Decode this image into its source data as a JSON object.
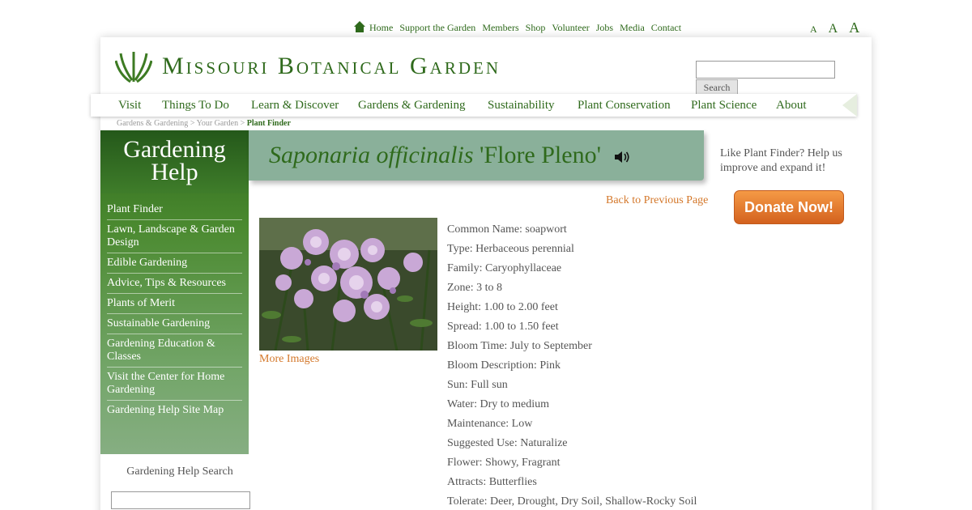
{
  "top_nav": {
    "items": [
      "Home",
      "Support the Garden",
      "Members",
      "Shop",
      "Volunteer",
      "Jobs",
      "Media",
      "Contact"
    ]
  },
  "font_size_controls": [
    "A",
    "A",
    "A"
  ],
  "logo": {
    "text": "Missouri Botanical Garden"
  },
  "site_search": {
    "value": "",
    "button_label": "Search"
  },
  "main_nav": {
    "items": [
      "Visit",
      "Things To Do",
      "Learn & Discover",
      "Gardens & Gardening",
      "Sustainability",
      "Plant Conservation",
      "Plant Science",
      "About"
    ]
  },
  "breadcrumb": {
    "items": [
      "Gardens & Gardening",
      "Your Garden"
    ],
    "separator": ">",
    "current": "Plant Finder"
  },
  "sidebar": {
    "heading_line1": "Gardening",
    "heading_line2": "Help",
    "items": [
      "Plant Finder",
      "Lawn, Landscape & Garden Design",
      "Edible Gardening",
      "Advice, Tips & Resources",
      "Plants of Merit",
      "Sustainable Gardening",
      "Gardening Education & Classes",
      "Visit the Center for Home Gardening",
      "Gardening Help Site Map"
    ],
    "search_label": "Gardening Help Search",
    "search_value": ""
  },
  "plant": {
    "genus_species": "Saponaria officinalis",
    "cultivar": "'Flore Pleno'",
    "back_link": "Back to Previous Page",
    "more_images": "More Images",
    "attributes": [
      "Common Name: soapwort",
      "Type: Herbaceous perennial",
      "Family: Caryophyllaceae",
      "Zone: 3 to 8",
      "Height: 1.00 to 2.00 feet",
      "Spread: 1.00 to 1.50 feet",
      "Bloom Time: July to September",
      "Bloom Description: Pink",
      "Sun: Full sun",
      "Water: Dry to medium",
      "Maintenance: Low",
      "Suggested Use: Naturalize",
      "Flower: Showy, Fragrant",
      "Attracts: Butterflies",
      "Tolerate: Deer, Drought, Dry Soil, Shallow-Rocky Soil"
    ]
  },
  "promo": {
    "text": "Like Plant Finder? Help us improve and expand it!",
    "donate_label": "Donate Now!"
  },
  "colors": {
    "brand_green": "#2f6a1c",
    "link_orange": "#d4782b",
    "title_band": "#8ab09a",
    "donate_orange": "#e47b2e"
  }
}
